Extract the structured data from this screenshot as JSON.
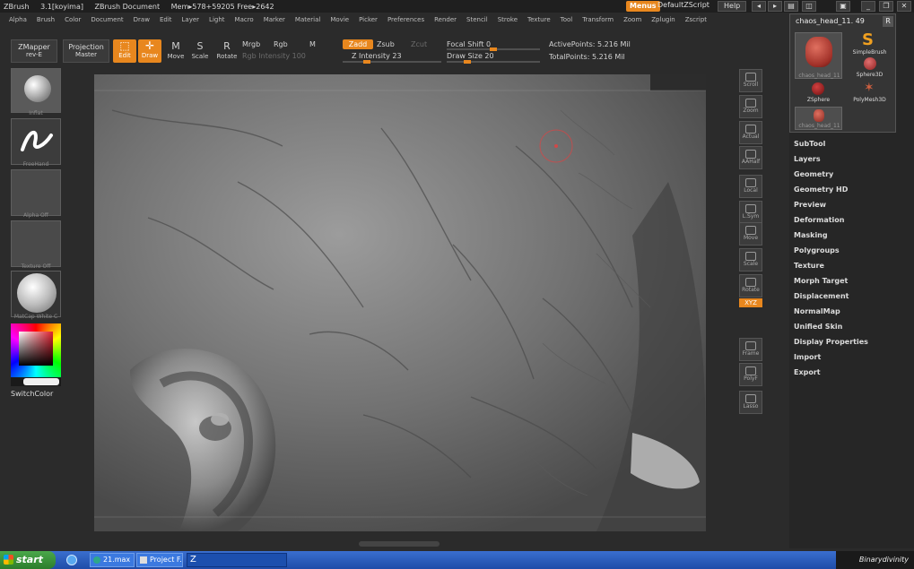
{
  "titlebar": {
    "app": "ZBrush",
    "version": "3.1[koyima]",
    "document": "ZBrush Document",
    "mem": "Mem▸578+59205 Free▸2642",
    "menus": "Menus",
    "script": "DefaultZScript",
    "help": "Help"
  },
  "menubar": [
    "Alpha",
    "Brush",
    "Color",
    "Document",
    "Draw",
    "Edit",
    "Layer",
    "Light",
    "Macro",
    "Marker",
    "Material",
    "Movie",
    "Picker",
    "Preferences",
    "Render",
    "Stencil",
    "Stroke",
    "Texture",
    "Tool",
    "Transform",
    "Zoom",
    "Zplugin",
    "Zscript"
  ],
  "toolbar": {
    "zmapper": "ZMapper",
    "zmapper_sub": "rev-E",
    "projection": "Projection",
    "projection_sub": "Master",
    "edit": "Edit",
    "draw": "Draw",
    "move": "Move",
    "scale": "Scale",
    "rotate": "Rotate",
    "mrgb": "Mrgb",
    "rgb": "Rgb",
    "m": "M",
    "rgb_intensity": "Rgb Intensity 100",
    "zadd": "Zadd",
    "zsub": "Zsub",
    "zcut": "Zcut",
    "z_intensity": "Z Intensity 23",
    "focal_shift": "Focal Shift 0",
    "draw_size": "Draw Size 20",
    "active_points": "ActivePoints: 5.216 Mil",
    "total_points": "TotalPoints: 5.216 Mil"
  },
  "sliders": {
    "z_intensity": 0.23,
    "focal_shift": 0.5,
    "draw_size": 0.2
  },
  "left_shelf": {
    "brush": "Inflat",
    "stroke": "FreeHand",
    "alpha": "Alpha Off",
    "texture": "Texture Off",
    "material": "MatCap White C",
    "switch_color": "SwitchColor"
  },
  "right_shelf": [
    "Scroll",
    "Zoom",
    "Actual",
    "AAHalf",
    "Local",
    "L.Sym",
    "Move",
    "Scale",
    "Rotate",
    "Frame",
    "PolyF",
    "Lasso"
  ],
  "right_shelf_xyz": "XYZ",
  "palette": {
    "subtool_name": "chaos_head_11. 49",
    "r_button": "R",
    "tools": [
      "chaos_head_11",
      "SimpleBrush",
      "Sphere3D",
      "ZSphere",
      "PolyMesh3D",
      "chaos_head_11"
    ],
    "items": [
      "SubTool",
      "Layers",
      "Geometry",
      "Geometry HD",
      "Preview",
      "Deformation",
      "Masking",
      "Polygroups",
      "Texture",
      "Morph Target",
      "Displacement",
      "NormalMap",
      "Unified Skin",
      "Display Properties",
      "Import",
      "Export"
    ]
  },
  "taskbar": {
    "start": "start",
    "items": [
      "21.max",
      "Project F..."
    ],
    "tray": "Binarydivinity"
  },
  "colors": {
    "accent": "#e8871e",
    "background": "#2b2b2b",
    "taskbar": "#245edb"
  }
}
